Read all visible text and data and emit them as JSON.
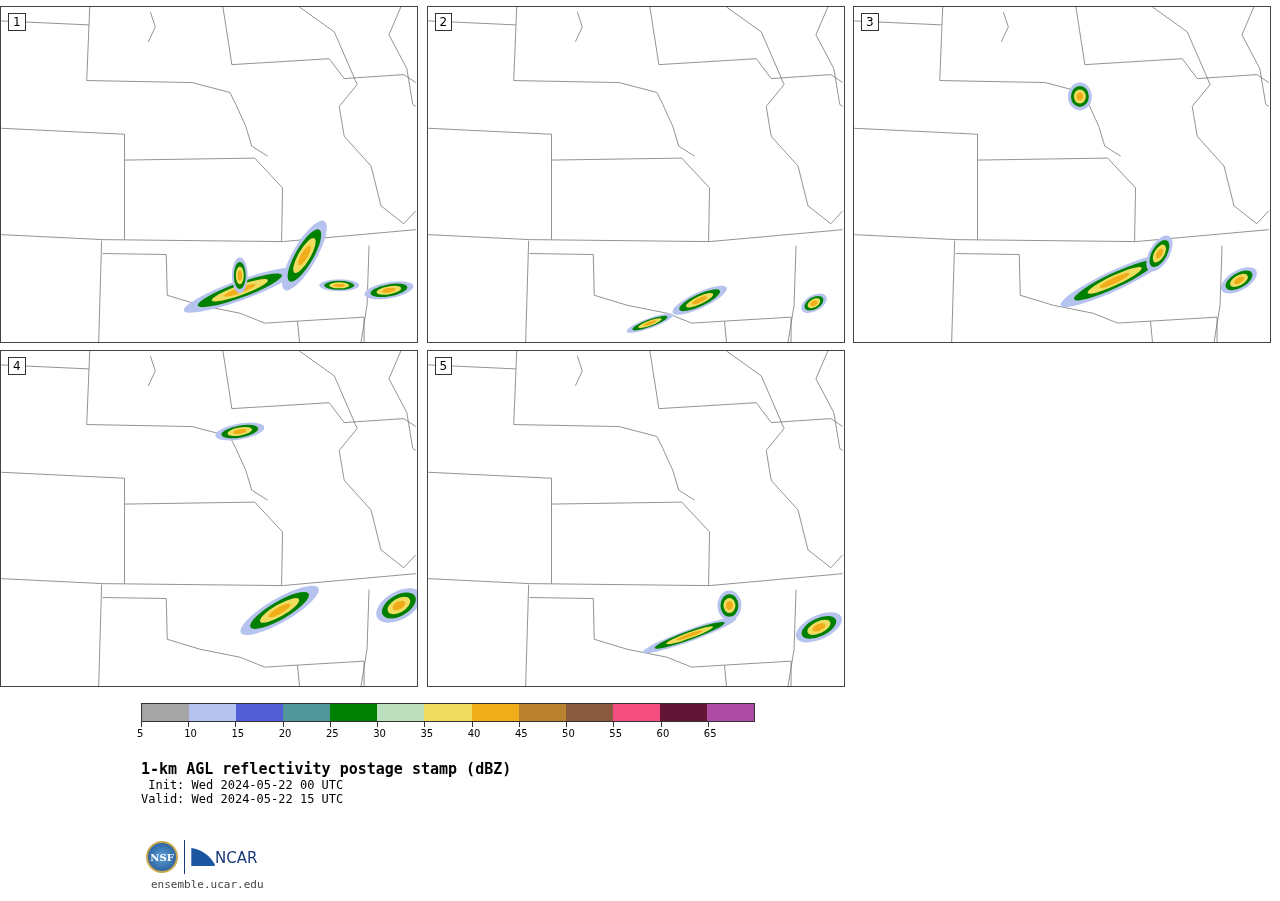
{
  "panels": [
    {
      "label": "1"
    },
    {
      "label": "2"
    },
    {
      "label": "3"
    },
    {
      "label": "4"
    },
    {
      "label": "5"
    }
  ],
  "colorbar": {
    "bins": [
      {
        "color": "#a5a5a5"
      },
      {
        "color": "#b7c3ef"
      },
      {
        "color": "#525ed6"
      },
      {
        "color": "#4f9599"
      },
      {
        "color": "#008000"
      },
      {
        "color": "#bedfbe"
      },
      {
        "color": "#f0dc5f"
      },
      {
        "color": "#f0ac19"
      },
      {
        "color": "#ba822e"
      },
      {
        "color": "#8a5a3f"
      },
      {
        "color": "#f44f80"
      },
      {
        "color": "#601634"
      },
      {
        "color": "#ad4ba5"
      }
    ],
    "ticks": [
      "5",
      "10",
      "15",
      "20",
      "25",
      "30",
      "35",
      "40",
      "45",
      "50",
      "55",
      "60",
      "65"
    ]
  },
  "title": "1-km AGL reflectivity postage stamp (dBZ)",
  "init": " Init: Wed 2024-05-22 00 UTC",
  "valid": "Valid: Wed 2024-05-22 15 UTC",
  "logos": {
    "nsf": "NSF",
    "ncar": "NCAR"
  },
  "url": "ensemble.ucar.edu"
}
